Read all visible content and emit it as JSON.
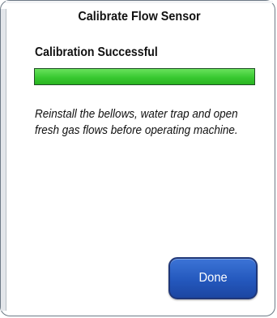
{
  "dialog": {
    "title": "Calibrate Flow Sensor",
    "status": "Calibration Successful",
    "progress": {
      "percent": 100,
      "color": "#39c931"
    },
    "instructions": "Reinstall the bellows, water trap  and open fresh gas flows before operating machine.",
    "done_label": "Done",
    "button_color": "#2458bd"
  }
}
